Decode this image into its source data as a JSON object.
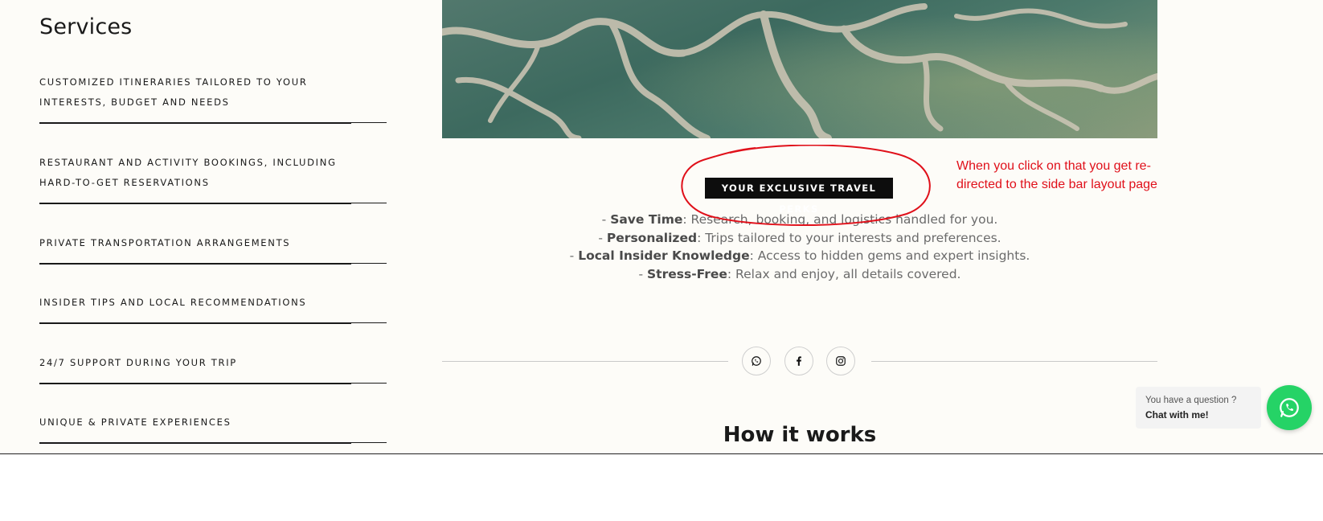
{
  "sidebar": {
    "title": "Services",
    "items": [
      {
        "label": "CUSTOMIZED ITINERARIES TAILORED TO YOUR INTERESTS, BUDGET AND NEEDS"
      },
      {
        "label": "RESTAURANT AND ACTIVITY BOOKINGS, INCLUDING HARD-TO-GET RESERVATIONS"
      },
      {
        "label": "PRIVATE TRANSPORTATION ARRANGEMENTS"
      },
      {
        "label": "INSIDER TIPS AND LOCAL RECOMMENDATIONS"
      },
      {
        "label": "24/7 SUPPORT DURING YOUR TRIP"
      },
      {
        "label": "UNIQUE & PRIVATE EXPERIENCES"
      }
    ]
  },
  "perks": {
    "badge": "YOUR EXCLUSIVE TRAVEL PERKS",
    "items": [
      {
        "prefix": "- ",
        "title": "Save Time",
        "text": ": Research, booking, and logistics handled for you."
      },
      {
        "prefix": "- ",
        "title": "Personalized",
        "text": ": Trips tailored to your interests and preferences."
      },
      {
        "prefix": "- ",
        "title": "Local Insider Knowledge",
        "text": ": Access to hidden gems and expert insights."
      },
      {
        "prefix": "- ",
        "title": "Stress-Free",
        "text": ": Relax and enjoy, all details covered."
      }
    ]
  },
  "annotation": {
    "text": "When you click on that you get re-directed to the side bar layout page",
    "color": "#e0101a"
  },
  "social": {
    "icons": [
      "whatsapp-icon",
      "facebook-icon",
      "instagram-icon"
    ]
  },
  "how_it_works": {
    "title": "How it works"
  },
  "chat": {
    "question": "You have a question ?",
    "cta": "Chat with me!",
    "color": "#25d366"
  },
  "colors": {
    "background": "#fdfcf8",
    "text": "#1a1a1a",
    "badge": "#0d0d0d"
  }
}
